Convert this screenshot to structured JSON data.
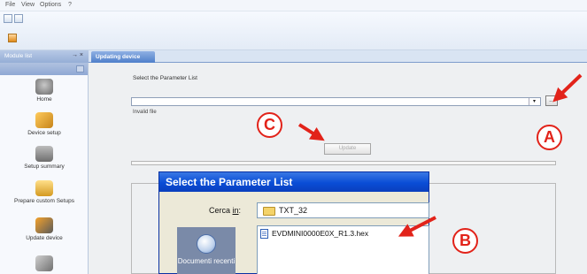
{
  "menu": {
    "file": "File",
    "view": "View",
    "options": "Options",
    "help": "?"
  },
  "module_panel": {
    "title": "Module list",
    "controls": "→ ×"
  },
  "active_tab": "Updating device",
  "sidebar": {
    "items": [
      {
        "label": "Home",
        "icon": "home-icon"
      },
      {
        "label": "Device setup",
        "icon": "device-setup-icon"
      },
      {
        "label": "Setup summary",
        "icon": "setup-summary-icon"
      },
      {
        "label": "Prepare custom Setups",
        "icon": "prepare-custom-setups-icon"
      },
      {
        "label": "Update device",
        "icon": "update-device-icon"
      },
      {
        "label": "",
        "icon": "wrench-icon"
      }
    ]
  },
  "update_panel": {
    "select_label": "Select the Parameter List",
    "path_value": "",
    "combo_arrow": "▾",
    "browse_label": "...",
    "status": "Invalid file",
    "update_button": "Update"
  },
  "dialog": {
    "title": "Select the Parameter List",
    "look_in_prefix": "Cerca ",
    "look_in_underline": "in",
    "look_in_suffix": ":",
    "folder": "TXT_32",
    "places_item": "Documenti recenti",
    "files": [
      "EVDMINI0000E0X_R1.3.hex"
    ]
  },
  "callouts": {
    "a": "A",
    "b": "B",
    "c": "C"
  },
  "colors": {
    "accent_red": "#e2231a",
    "dialog_title_blue": "#0a4dd6",
    "tab_blue": "#4f7fca"
  }
}
